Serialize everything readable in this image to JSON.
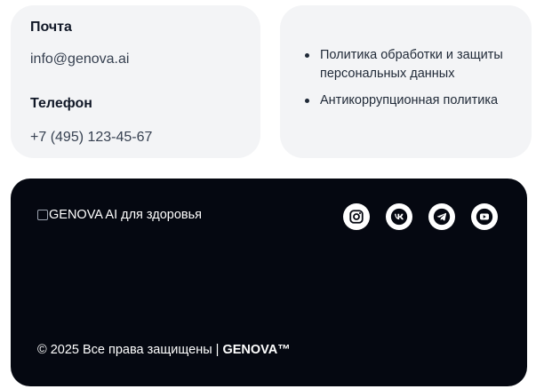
{
  "contacts": {
    "email_label": "Почта",
    "email_value": "info@genova.ai",
    "phone_label": "Телефон",
    "phone_value": "+7 (495) 123-45-67"
  },
  "legal_links": [
    {
      "label": "Политика обработки и защиты персональных данных"
    },
    {
      "label": "Антикоррупционная политика"
    }
  ],
  "footer": {
    "logo_alt": "GENOVA AI для здоровья",
    "social_icons": [
      "instagram-icon",
      "vk-icon",
      "telegram-icon",
      "youtube-icon"
    ],
    "copyright_prefix": "© 2025 Все права защищены | ",
    "copyright_brand": "GENOVA™"
  },
  "colors": {
    "card_bg": "#f3f4f6",
    "footer_bg": "#050811",
    "text_dark": "#111827",
    "icon_circle": "#ffffff"
  }
}
